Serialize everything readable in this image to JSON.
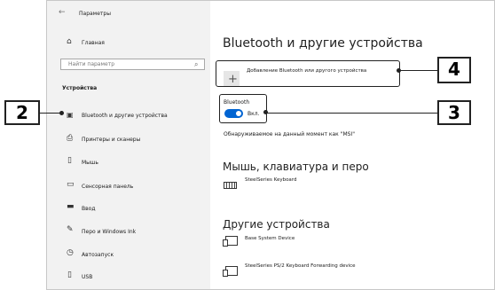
{
  "window": {
    "title": "Параметры"
  },
  "sidebar": {
    "home_label": "Главная",
    "search_placeholder": "Найти параметр",
    "section_title": "Устройства",
    "items": [
      {
        "label": "Bluetooth и другие устройства",
        "icon": "bluetooth-devices-icon"
      },
      {
        "label": "Принтеры и сканеры",
        "icon": "printer-icon"
      },
      {
        "label": "Мышь",
        "icon": "mouse-icon"
      },
      {
        "label": "Сенсорная панель",
        "icon": "touchpad-icon"
      },
      {
        "label": "Ввод",
        "icon": "keyboard-icon"
      },
      {
        "label": "Перо и Windows Ink",
        "icon": "pen-icon"
      },
      {
        "label": "Автозапуск",
        "icon": "autoplay-icon"
      },
      {
        "label": "USB",
        "icon": "usb-icon"
      }
    ]
  },
  "main": {
    "title": "Bluetooth и другие устройства",
    "add_device_label": "Добавление Bluetooth или другого устройства",
    "bluetooth_label": "Bluetooth",
    "toggle_state": "Вкл.",
    "discoverable_text": "Обнаруживаемое на данный момент как \"MSI\"",
    "mouse_section_title": "Мышь, клавиатура и перо",
    "mouse_devices": [
      {
        "name": "SteelSeries Keyboard"
      }
    ],
    "other_section_title": "Другие устройства",
    "other_devices": [
      {
        "name": "Base System Device"
      },
      {
        "name": "SteelSeries PS/2 Keyboard Forwarding device"
      }
    ]
  },
  "callouts": {
    "c2": "2",
    "c3": "3",
    "c4": "4"
  },
  "colors": {
    "accent": "#0064d2",
    "sidebar_bg": "#f2f2f2"
  }
}
